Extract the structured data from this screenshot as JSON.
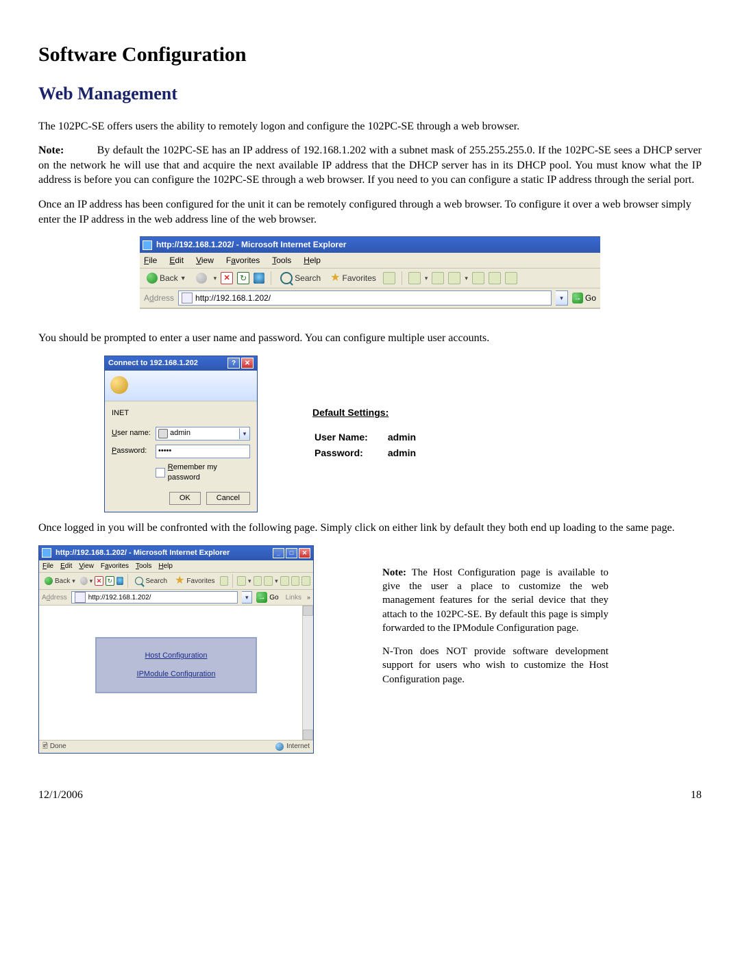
{
  "heading": "Software Configuration",
  "subheading": "Web Management",
  "intro": "The 102PC-SE offers users the ability to remotely logon and configure the 102PC-SE through a web browser.",
  "note1_lead": "Note:",
  "note1": "By default the 102PC-SE has an IP address of 192.168.1.202 with a subnet mask of 255.255.255.0.  If the 102PC-SE sees a DHCP server on the network he will use that and acquire the next available IP address that the DHCP server has in its DHCP pool.  You must know what the IP address is before you can configure the 102PC-SE through a web browser.  If you need to you can configure a static IP address through the serial port.",
  "para2": "Once an IP address has been configured for the unit it can be remotely configured through a web browser.  To configure it over a web browser simply enter the IP address in the web address line of the web browser.",
  "ie": {
    "title": "http://192.168.1.202/ - Microsoft Internet Explorer",
    "menu": {
      "file": "File",
      "edit": "Edit",
      "view": "View",
      "favorites": "Favorites",
      "tools": "Tools",
      "help": "Help"
    },
    "toolbar": {
      "back": "Back",
      "search": "Search",
      "favorites": "Favorites"
    },
    "addr_label": "Address",
    "addr_value": "http://192.168.1.202/",
    "go": "Go",
    "links": "Links"
  },
  "para3": "You should be prompted to enter a user name and password.  You can configure multiple user accounts.",
  "login": {
    "title": "Connect to 192.168.1.202",
    "domain": "INET",
    "un_label": "User name:",
    "pw_label": "Password:",
    "un_value": "admin",
    "pw_value": "•••••",
    "remember": "Remember my password",
    "ok": "OK",
    "cancel": "Cancel"
  },
  "defaults": {
    "header": "Default Settings:",
    "un_label": "User Name:",
    "un_value": "admin",
    "pw_label": "Password:",
    "pw_value": "admin"
  },
  "para4": "Once logged in you will be confronted with the following page.  Simply click on either link by default they both end up loading to the same page.",
  "ie2": {
    "status_done": "Done",
    "zone": "Internet",
    "links": {
      "host": "Host Configuration",
      "ipmod": "IPModule Configuration"
    }
  },
  "sidenote": {
    "lead": "Note:",
    "p1": "The Host Configuration page is available to give the user a place to customize the web management features for the serial device that they attach to the 102PC-SE.  By default this page is simply forwarded to the IPModule Configuration page.",
    "p2": "N-Tron does NOT provide software development support for users who wish to customize the Host Configuration page."
  },
  "footer": {
    "date": "12/1/2006",
    "page": "18"
  }
}
